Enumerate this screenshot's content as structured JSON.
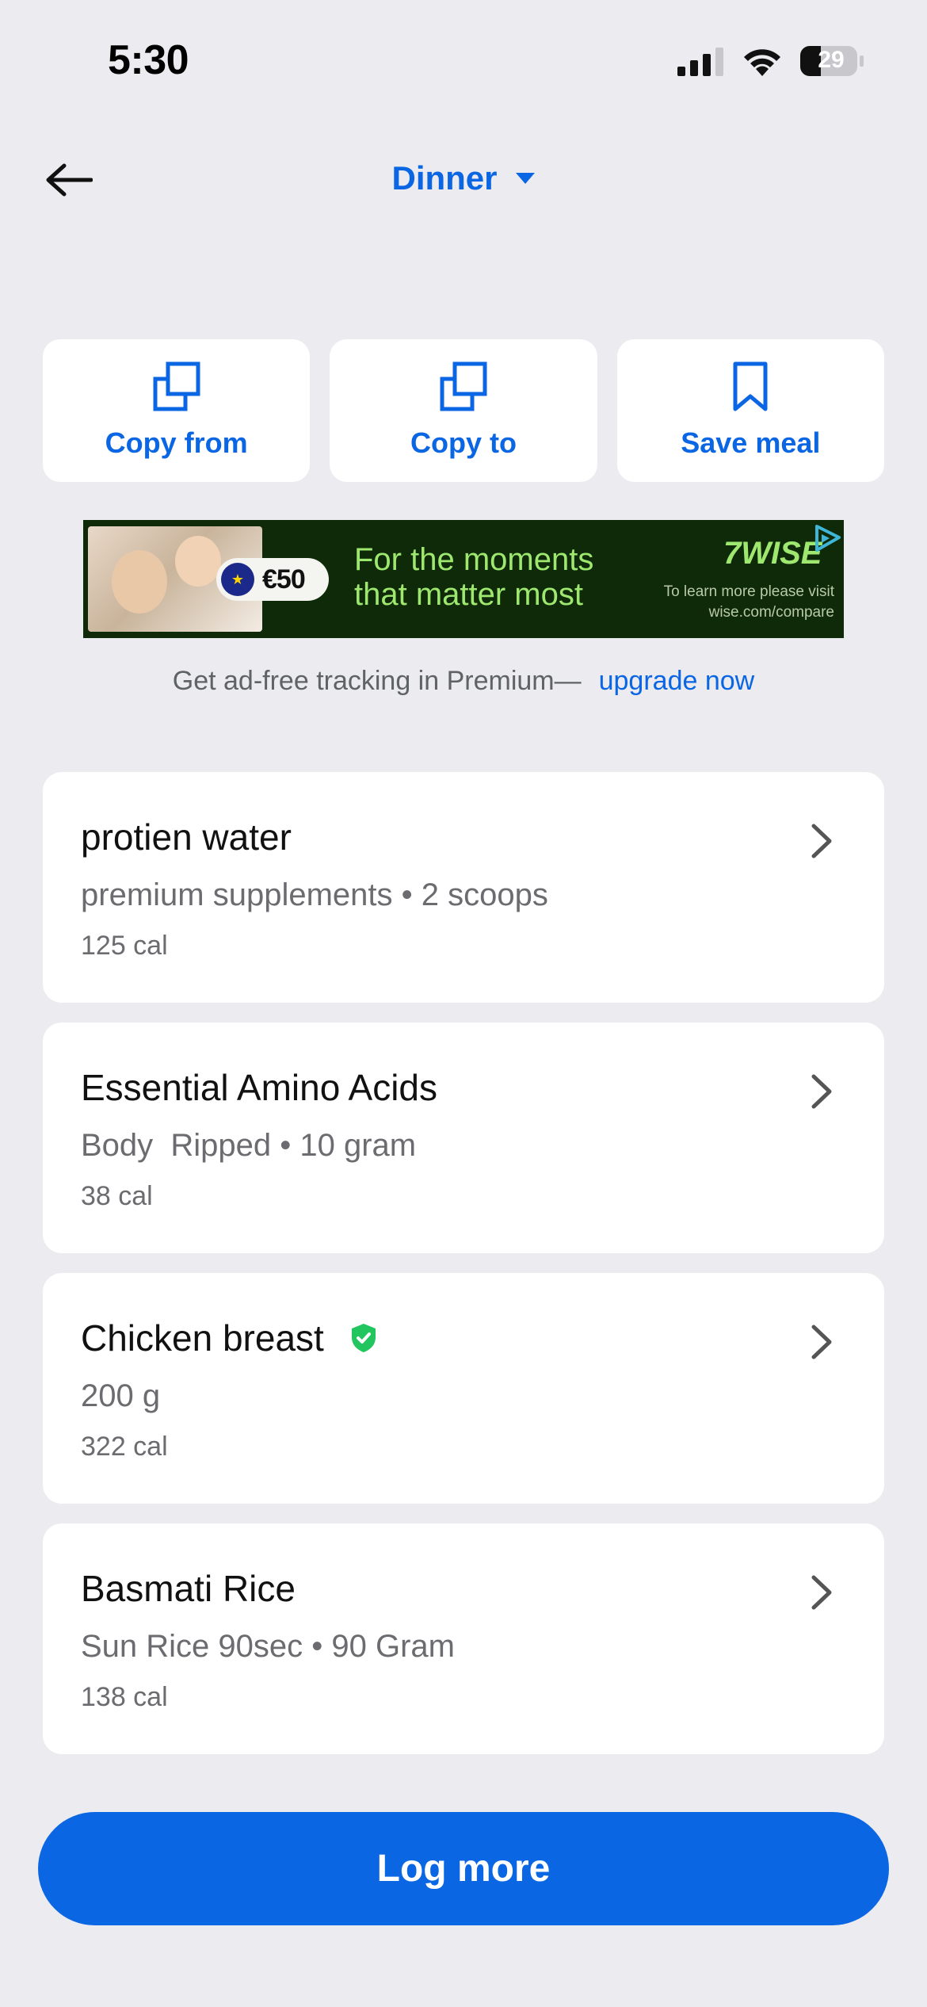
{
  "status_bar": {
    "time": "5:30",
    "battery": "29",
    "icons": [
      "signal-icon",
      "wifi-icon",
      "battery-icon"
    ]
  },
  "header": {
    "back_icon": "arrow-left-icon",
    "meal": "Dinner",
    "dropdown_icon": "caret-down-icon"
  },
  "actions": [
    {
      "label": "Copy from",
      "icon": "copy-icon"
    },
    {
      "label": "Copy to",
      "icon": "copy-icon"
    },
    {
      "label": "Save meal",
      "icon": "bookmark-icon"
    }
  ],
  "ad": {
    "offer": "€50",
    "headline_line1": "For the moments",
    "headline_line2": "that matter most",
    "brand": "7WISE",
    "disclaimer": "To learn more please visit wise.com/compare"
  },
  "premium": {
    "text": "Get ad-free tracking in Premium—",
    "link": "upgrade now"
  },
  "foods": [
    {
      "name": "protien water",
      "detail": "premium supplements • 2 scoops",
      "calories": "125 cal",
      "verified": false
    },
    {
      "name": "Essential Amino Acids",
      "detail": "Body  Ripped • 10 gram",
      "calories": "38 cal",
      "verified": false
    },
    {
      "name": "Chicken breast",
      "detail": "200 g",
      "calories": "322 cal",
      "verified": true
    },
    {
      "name": "Basmati Rice",
      "detail": "Sun Rice 90sec • 90 Gram",
      "calories": "138 cal",
      "verified": false
    }
  ],
  "log_more": {
    "label": "Log more"
  },
  "colors": {
    "accent": "#0b66e4",
    "background": "#ebebf0",
    "verified": "#22c55e",
    "ad_background": "#0f2a08",
    "ad_text": "#9fe870"
  }
}
